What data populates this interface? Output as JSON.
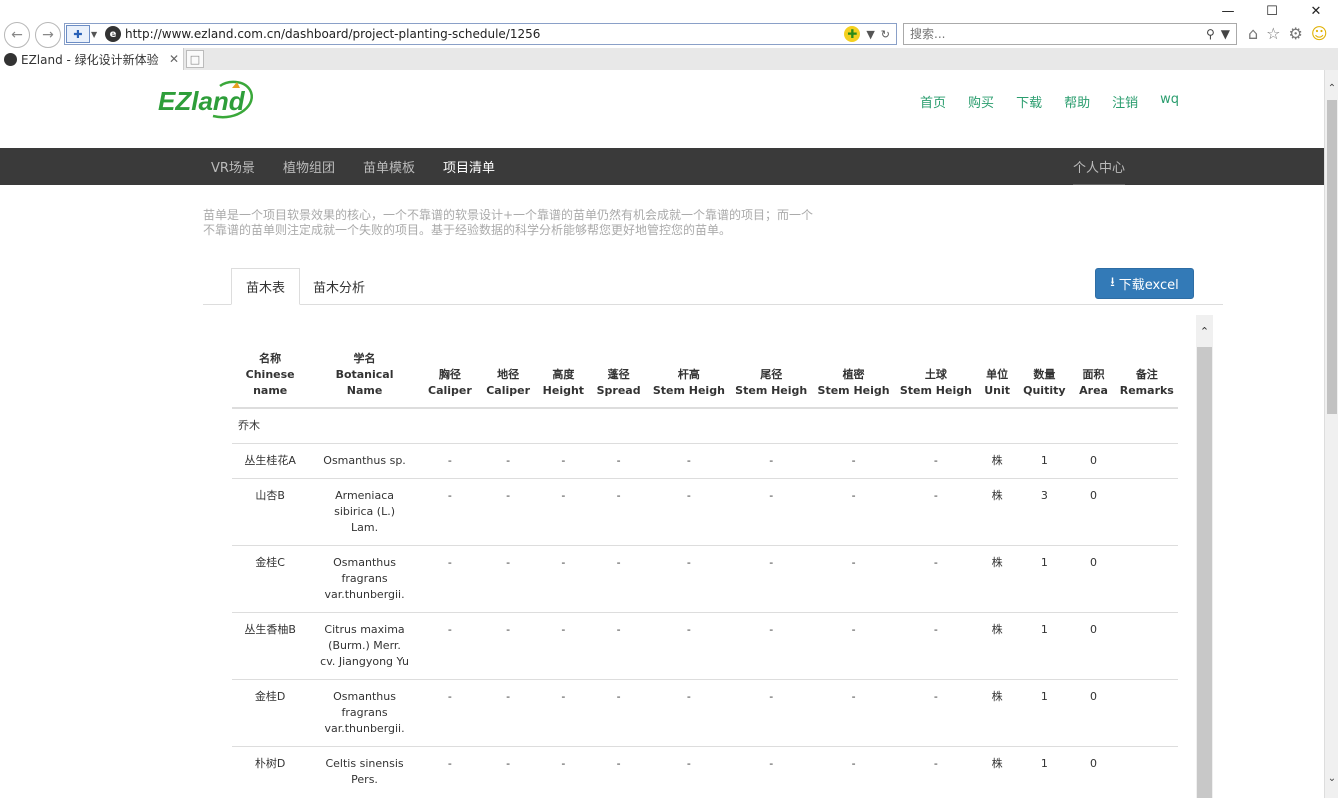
{
  "browser": {
    "url": "http://www.ezland.com.cn/dashboard/project-planting-schedule/1256",
    "search_placeholder": "搜索...",
    "tab_title": "EZland - 绿化设计新体验"
  },
  "header": {
    "logo_text": "EZland",
    "nav": [
      "首页",
      "购买",
      "下载",
      "帮助",
      "注销",
      "wq"
    ]
  },
  "menu": {
    "items": [
      "VR场景",
      "植物组团",
      "苗单模板",
      "项目清单"
    ],
    "active_index": 3,
    "right": "个人中心"
  },
  "intro": "苗单是一个项目软景效果的核心，一个不靠谱的软景设计+一个靠谱的苗单仍然有机会成就一个靠谱的项目；而一个不靠谱的苗单则注定成就一个失败的项目。基于经验数据的科学分析能够帮您更好地管控您的苗单。",
  "tabs": [
    "苗木表",
    "苗木分析"
  ],
  "download_label": "下载excel",
  "table": {
    "headers": [
      [
        "名称",
        "Chinese name"
      ],
      [
        "学名",
        "Botanical",
        "Name"
      ],
      [
        "胸径",
        "Caliper"
      ],
      [
        "地径",
        "Caliper"
      ],
      [
        "高度",
        "Height"
      ],
      [
        "蓬径",
        "Spread"
      ],
      [
        "杆高",
        "Stem Heigh"
      ],
      [
        "尾径",
        "Stem Heigh"
      ],
      [
        "植密",
        "Stem Heigh"
      ],
      [
        "土球",
        "Stem Heigh"
      ],
      [
        "单位",
        "Unit"
      ],
      [
        "数量",
        "Quitity"
      ],
      [
        "面积",
        "Area"
      ],
      [
        "备注",
        "Remarks"
      ]
    ],
    "group": "乔木",
    "rows": [
      {
        "name": "丛生桂花A",
        "botanical": "Osmanthus sp.",
        "unit": "株",
        "qty": "1",
        "area": "0"
      },
      {
        "name": "山杏B",
        "botanical": "Armeniaca sibirica (L.) Lam.",
        "unit": "株",
        "qty": "3",
        "area": "0"
      },
      {
        "name": "金桂C",
        "botanical": "Osmanthus fragrans var.thunbergii.",
        "unit": "株",
        "qty": "1",
        "area": "0"
      },
      {
        "name": "丛生香柚B",
        "botanical": "Citrus maxima (Burm.) Merr. cv. Jiangyong Yu",
        "unit": "株",
        "qty": "1",
        "area": "0"
      },
      {
        "name": "金桂D",
        "botanical": "Osmanthus fragrans var.thunbergii.",
        "unit": "株",
        "qty": "1",
        "area": "0"
      },
      {
        "name": "朴树D",
        "botanical": "Celtis sinensis Pers.",
        "unit": "株",
        "qty": "1",
        "area": "0"
      }
    ],
    "dash": "-"
  }
}
